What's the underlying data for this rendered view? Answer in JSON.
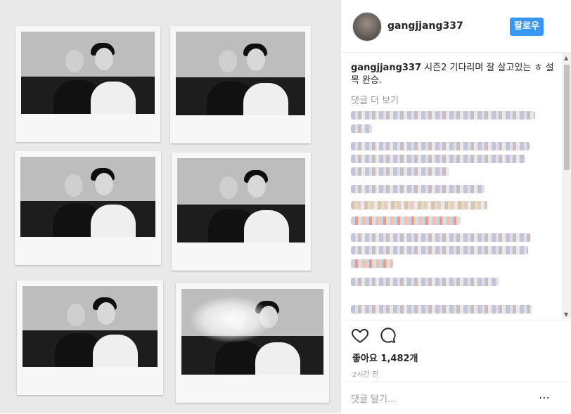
{
  "post": {
    "username": "gangjjang337",
    "follow_label": "팔로우",
    "caption_user": "gangjjang337",
    "caption_text": " 시즌2 기다리며 잘 살고있는 ㅎ 설목 완승.",
    "load_more": "댓글 더 보기",
    "likes_label": "좋아요",
    "likes_count": "1,482개",
    "time_ago": "2시간 전",
    "comment_placeholder": "댓글 달기...",
    "more_icon": "⋯"
  },
  "colors": {
    "accent": "#3897f0",
    "text": "#262626",
    "muted": "#999999"
  },
  "icons": [
    "heart-icon",
    "comment-icon",
    "more-options-icon",
    "scroll-up-icon",
    "scroll-down-icon"
  ]
}
